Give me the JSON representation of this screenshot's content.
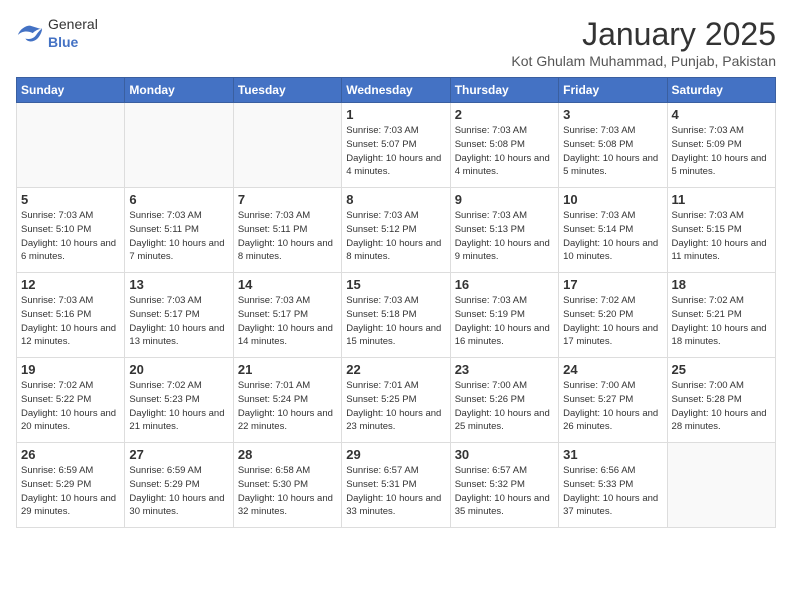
{
  "header": {
    "logo": {
      "general": "General",
      "blue": "Blue"
    },
    "title": "January 2025",
    "subtitle": "Kot Ghulam Muhammad, Punjab, Pakistan"
  },
  "weekdays": [
    "Sunday",
    "Monday",
    "Tuesday",
    "Wednesday",
    "Thursday",
    "Friday",
    "Saturday"
  ],
  "weeks": [
    [
      {
        "day": "",
        "sunrise": "",
        "sunset": "",
        "daylight": ""
      },
      {
        "day": "",
        "sunrise": "",
        "sunset": "",
        "daylight": ""
      },
      {
        "day": "",
        "sunrise": "",
        "sunset": "",
        "daylight": ""
      },
      {
        "day": "1",
        "sunrise": "Sunrise: 7:03 AM",
        "sunset": "Sunset: 5:07 PM",
        "daylight": "Daylight: 10 hours and 4 minutes."
      },
      {
        "day": "2",
        "sunrise": "Sunrise: 7:03 AM",
        "sunset": "Sunset: 5:08 PM",
        "daylight": "Daylight: 10 hours and 4 minutes."
      },
      {
        "day": "3",
        "sunrise": "Sunrise: 7:03 AM",
        "sunset": "Sunset: 5:08 PM",
        "daylight": "Daylight: 10 hours and 5 minutes."
      },
      {
        "day": "4",
        "sunrise": "Sunrise: 7:03 AM",
        "sunset": "Sunset: 5:09 PM",
        "daylight": "Daylight: 10 hours and 5 minutes."
      }
    ],
    [
      {
        "day": "5",
        "sunrise": "Sunrise: 7:03 AM",
        "sunset": "Sunset: 5:10 PM",
        "daylight": "Daylight: 10 hours and 6 minutes."
      },
      {
        "day": "6",
        "sunrise": "Sunrise: 7:03 AM",
        "sunset": "Sunset: 5:11 PM",
        "daylight": "Daylight: 10 hours and 7 minutes."
      },
      {
        "day": "7",
        "sunrise": "Sunrise: 7:03 AM",
        "sunset": "Sunset: 5:11 PM",
        "daylight": "Daylight: 10 hours and 8 minutes."
      },
      {
        "day": "8",
        "sunrise": "Sunrise: 7:03 AM",
        "sunset": "Sunset: 5:12 PM",
        "daylight": "Daylight: 10 hours and 8 minutes."
      },
      {
        "day": "9",
        "sunrise": "Sunrise: 7:03 AM",
        "sunset": "Sunset: 5:13 PM",
        "daylight": "Daylight: 10 hours and 9 minutes."
      },
      {
        "day": "10",
        "sunrise": "Sunrise: 7:03 AM",
        "sunset": "Sunset: 5:14 PM",
        "daylight": "Daylight: 10 hours and 10 minutes."
      },
      {
        "day": "11",
        "sunrise": "Sunrise: 7:03 AM",
        "sunset": "Sunset: 5:15 PM",
        "daylight": "Daylight: 10 hours and 11 minutes."
      }
    ],
    [
      {
        "day": "12",
        "sunrise": "Sunrise: 7:03 AM",
        "sunset": "Sunset: 5:16 PM",
        "daylight": "Daylight: 10 hours and 12 minutes."
      },
      {
        "day": "13",
        "sunrise": "Sunrise: 7:03 AM",
        "sunset": "Sunset: 5:17 PM",
        "daylight": "Daylight: 10 hours and 13 minutes."
      },
      {
        "day": "14",
        "sunrise": "Sunrise: 7:03 AM",
        "sunset": "Sunset: 5:17 PM",
        "daylight": "Daylight: 10 hours and 14 minutes."
      },
      {
        "day": "15",
        "sunrise": "Sunrise: 7:03 AM",
        "sunset": "Sunset: 5:18 PM",
        "daylight": "Daylight: 10 hours and 15 minutes."
      },
      {
        "day": "16",
        "sunrise": "Sunrise: 7:03 AM",
        "sunset": "Sunset: 5:19 PM",
        "daylight": "Daylight: 10 hours and 16 minutes."
      },
      {
        "day": "17",
        "sunrise": "Sunrise: 7:02 AM",
        "sunset": "Sunset: 5:20 PM",
        "daylight": "Daylight: 10 hours and 17 minutes."
      },
      {
        "day": "18",
        "sunrise": "Sunrise: 7:02 AM",
        "sunset": "Sunset: 5:21 PM",
        "daylight": "Daylight: 10 hours and 18 minutes."
      }
    ],
    [
      {
        "day": "19",
        "sunrise": "Sunrise: 7:02 AM",
        "sunset": "Sunset: 5:22 PM",
        "daylight": "Daylight: 10 hours and 20 minutes."
      },
      {
        "day": "20",
        "sunrise": "Sunrise: 7:02 AM",
        "sunset": "Sunset: 5:23 PM",
        "daylight": "Daylight: 10 hours and 21 minutes."
      },
      {
        "day": "21",
        "sunrise": "Sunrise: 7:01 AM",
        "sunset": "Sunset: 5:24 PM",
        "daylight": "Daylight: 10 hours and 22 minutes."
      },
      {
        "day": "22",
        "sunrise": "Sunrise: 7:01 AM",
        "sunset": "Sunset: 5:25 PM",
        "daylight": "Daylight: 10 hours and 23 minutes."
      },
      {
        "day": "23",
        "sunrise": "Sunrise: 7:00 AM",
        "sunset": "Sunset: 5:26 PM",
        "daylight": "Daylight: 10 hours and 25 minutes."
      },
      {
        "day": "24",
        "sunrise": "Sunrise: 7:00 AM",
        "sunset": "Sunset: 5:27 PM",
        "daylight": "Daylight: 10 hours and 26 minutes."
      },
      {
        "day": "25",
        "sunrise": "Sunrise: 7:00 AM",
        "sunset": "Sunset: 5:28 PM",
        "daylight": "Daylight: 10 hours and 28 minutes."
      }
    ],
    [
      {
        "day": "26",
        "sunrise": "Sunrise: 6:59 AM",
        "sunset": "Sunset: 5:29 PM",
        "daylight": "Daylight: 10 hours and 29 minutes."
      },
      {
        "day": "27",
        "sunrise": "Sunrise: 6:59 AM",
        "sunset": "Sunset: 5:29 PM",
        "daylight": "Daylight: 10 hours and 30 minutes."
      },
      {
        "day": "28",
        "sunrise": "Sunrise: 6:58 AM",
        "sunset": "Sunset: 5:30 PM",
        "daylight": "Daylight: 10 hours and 32 minutes."
      },
      {
        "day": "29",
        "sunrise": "Sunrise: 6:57 AM",
        "sunset": "Sunset: 5:31 PM",
        "daylight": "Daylight: 10 hours and 33 minutes."
      },
      {
        "day": "30",
        "sunrise": "Sunrise: 6:57 AM",
        "sunset": "Sunset: 5:32 PM",
        "daylight": "Daylight: 10 hours and 35 minutes."
      },
      {
        "day": "31",
        "sunrise": "Sunrise: 6:56 AM",
        "sunset": "Sunset: 5:33 PM",
        "daylight": "Daylight: 10 hours and 37 minutes."
      },
      {
        "day": "",
        "sunrise": "",
        "sunset": "",
        "daylight": ""
      }
    ]
  ]
}
